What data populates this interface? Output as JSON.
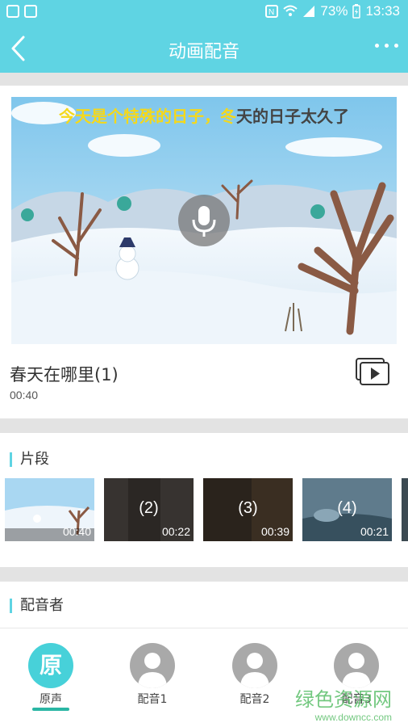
{
  "status_bar": {
    "battery": "73%",
    "time": "13:33"
  },
  "header": {
    "title": "动画配音"
  },
  "video": {
    "subtitle_played": "今天是个特殊的日子，冬",
    "subtitle_rest": "天的日子太久了"
  },
  "lesson": {
    "title": "春天在哪里(1)",
    "duration": "00:40"
  },
  "segments": {
    "label": "片段",
    "items": [
      {
        "label": "",
        "duration": "00:40"
      },
      {
        "label": "(2)",
        "duration": "00:22"
      },
      {
        "label": "(3)",
        "duration": "00:39"
      },
      {
        "label": "(4)",
        "duration": "00:21"
      }
    ]
  },
  "dubbers": {
    "label": "配音者",
    "items": [
      {
        "avatar_text": "原",
        "name": "原声"
      },
      {
        "name": "配音1"
      },
      {
        "name": "配音2"
      },
      {
        "name": "配音3"
      }
    ]
  },
  "watermark": {
    "line1": "绿色资源网",
    "line2": "www.downcc.com"
  },
  "colors": {
    "accent": "#5fd4e3",
    "active_tab": "#2ab6a4",
    "highlight_subtitle": "#f5d81a"
  }
}
